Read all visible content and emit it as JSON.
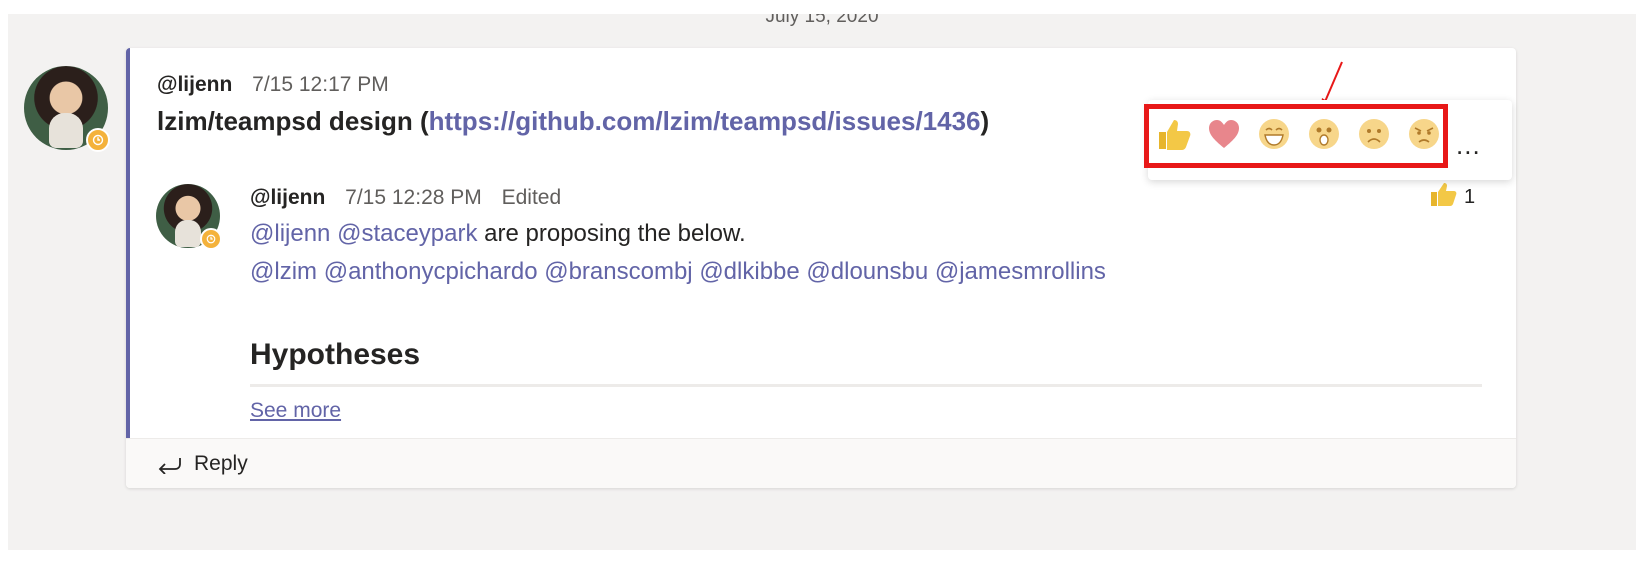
{
  "date_separator": "July 15, 2020",
  "post": {
    "author": "@lijenn",
    "timestamp": "7/15 12:17 PM",
    "title_text": "lzim/teampsd design (",
    "title_link": "https://github.com/lzim/teampsd/issues/1436",
    "title_end": ")"
  },
  "reply": {
    "author": "@lijenn",
    "timestamp": "7/15 12:28 PM",
    "edited": "Edited",
    "line1_mentions": [
      "@lijenn",
      "@staceypark"
    ],
    "line1_text": " are proposing the below.",
    "line2_mentions": [
      "@lzim",
      "@anthonycpichardo",
      "@branscombj",
      "@dlkibbe",
      "@dlounsbu",
      "@jamesmrollins"
    ],
    "heading": "Hypotheses",
    "see_more": "See more",
    "like_count": "1"
  },
  "reply_bar": {
    "label": "Reply"
  },
  "reactions": [
    {
      "name": "like-icon",
      "color": "#f3c846"
    },
    {
      "name": "heart-icon",
      "color": "#e8868c"
    },
    {
      "name": "laugh-icon",
      "color": "#f7d68a"
    },
    {
      "name": "surprised-icon",
      "color": "#f7d68a"
    },
    {
      "name": "sad-icon",
      "color": "#f7d68a"
    },
    {
      "name": "angry-icon",
      "color": "#f7d68a"
    }
  ],
  "more_options": "...",
  "colors": {
    "accent": "#6264a7",
    "highlight": "#e81818",
    "status": "#f4b23b"
  }
}
